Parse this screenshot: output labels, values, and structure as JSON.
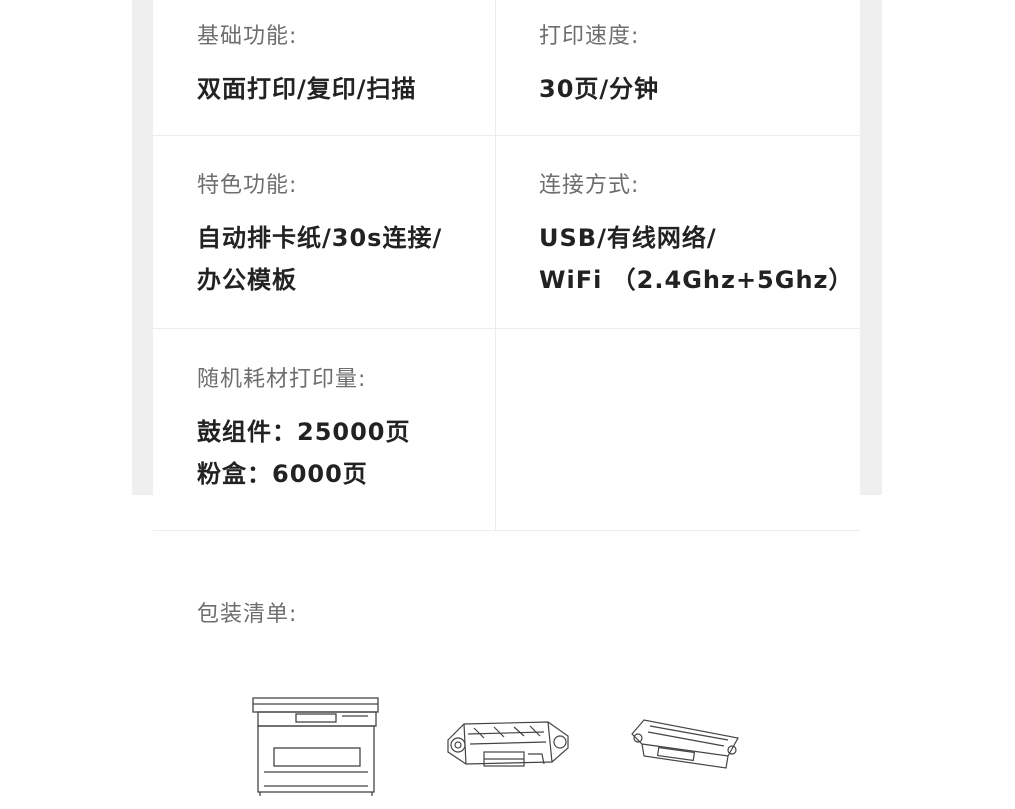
{
  "specs": [
    {
      "label": "基础功能:",
      "lines": [
        "双面打印/复印/扫描"
      ]
    },
    {
      "label": "打印速度:",
      "lines": [
        "30页/分钟"
      ]
    },
    {
      "label": "特色功能:",
      "lines": [
        "自动排卡纸/30s连接/",
        "办公模板"
      ]
    },
    {
      "label": "连接方式:",
      "lines": [
        "USB/有线网络/",
        "WiFi （2.4Ghz+5Ghz）"
      ]
    },
    {
      "label": "随机耗材打印量:",
      "lines": [
        "鼓组件：25000页",
        "粉盒：6000页"
      ]
    }
  ],
  "package": {
    "label": "包装清单:",
    "items": [
      "printer-illustration",
      "drum-unit-illustration",
      "toner-cartridge-illustration"
    ]
  }
}
